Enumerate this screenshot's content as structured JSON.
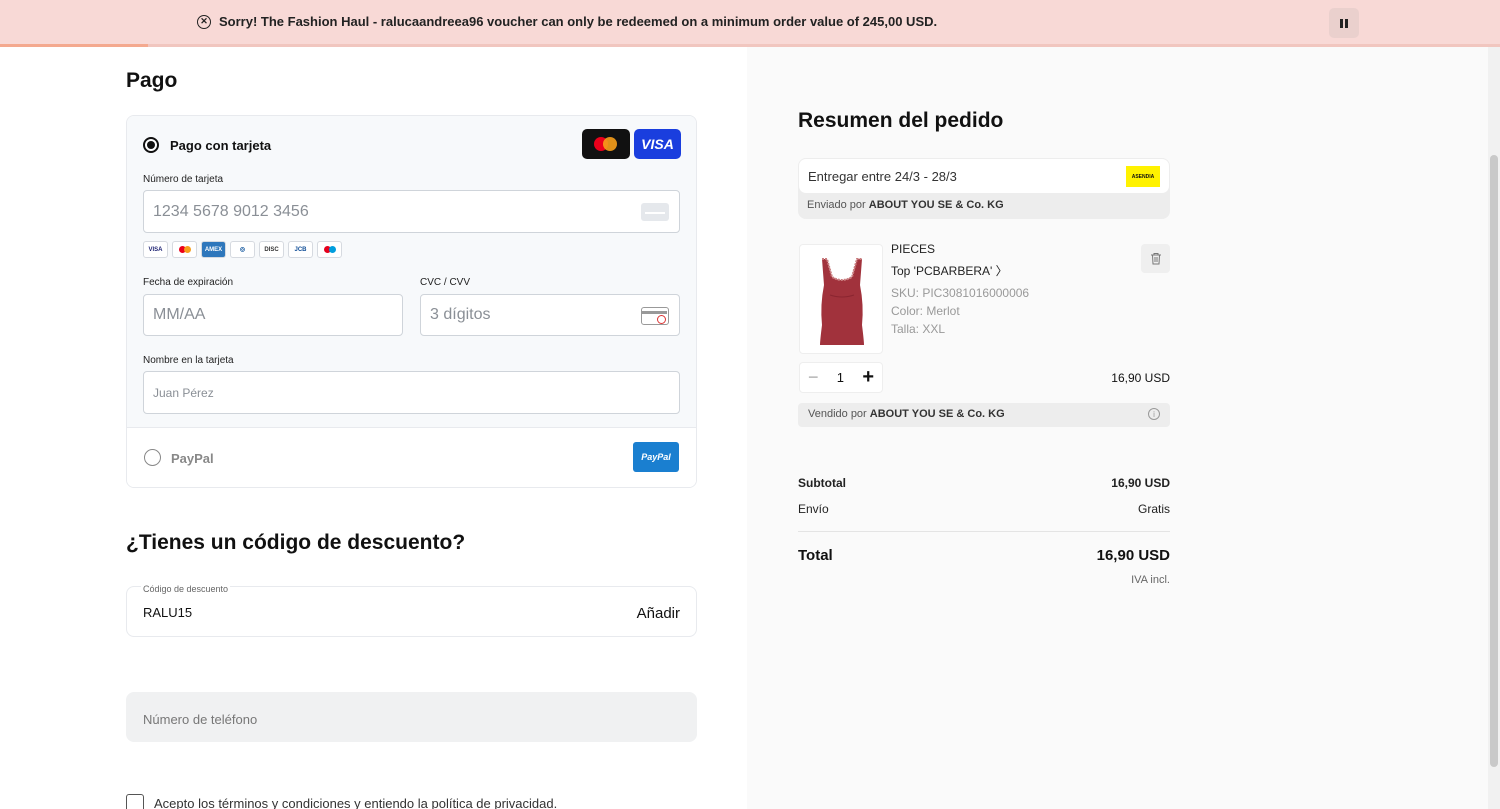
{
  "banner": {
    "message": "Sorry! The Fashion Haul - ralucaandreea96 voucher can only be redeemed on a minimum order value of 245,00 USD.",
    "close_icon": "x-circle-icon",
    "pause_icon": "pause-icon",
    "background": "#f8d9d6"
  },
  "payment": {
    "title": "Pago",
    "card_option_label": "Pago con tarjeta",
    "card_option_selected": true,
    "card_logos": [
      "mastercard",
      "VISA"
    ],
    "card_number_label": "Número de tarjeta",
    "card_number_placeholder": "1234 5678 9012 3456",
    "accepted_brands": [
      "VISA",
      "MC",
      "AMEX",
      "DINERS",
      "DISCOVER",
      "JCB",
      "MAESTRO"
    ],
    "expiry_label": "Fecha de expiración",
    "expiry_placeholder": "MM/AA",
    "cvc_label": "CVC / CVV",
    "cvc_placeholder": "3 dígitos",
    "name_label": "Nombre en la tarjeta",
    "name_placeholder": "Juan Pérez",
    "paypal_label": "PayPal",
    "paypal_logo_text": "PayPal"
  },
  "discount": {
    "title": "¿Tienes un código de descuento?",
    "field_label": "Código de descuento",
    "value": "RALU15",
    "add_label": "Añadir"
  },
  "phone": {
    "placeholder": "Número de teléfono"
  },
  "terms": {
    "label": "Acepto los términos y condiciones y entiendo la política de privacidad."
  },
  "summary": {
    "title": "Resumen del pedido",
    "delivery_text": "Entregar entre 24/3 - 28/3",
    "carrier_logo": "ASENDIA",
    "shipped_by_prefix": "Enviado por",
    "shipped_by_name": "ABOUT YOU SE & Co. KG",
    "item": {
      "brand": "PIECES",
      "name": "Top 'PCBARBERA' 〉",
      "sku": "SKU: PIC3081016000006",
      "color": "Color: Merlot",
      "size": "Talla: XXL",
      "quantity": "1",
      "price": "16,90 USD",
      "image_color": "#a1323c"
    },
    "sold_by_prefix": "Vendido por",
    "sold_by_name": "ABOUT YOU SE & Co. KG",
    "subtotal_label": "Subtotal",
    "subtotal_value": "16,90 USD",
    "shipping_label": "Envío",
    "shipping_value": "Gratis",
    "total_label": "Total",
    "total_value": "16,90 USD",
    "tax_note": "IVA incl."
  }
}
